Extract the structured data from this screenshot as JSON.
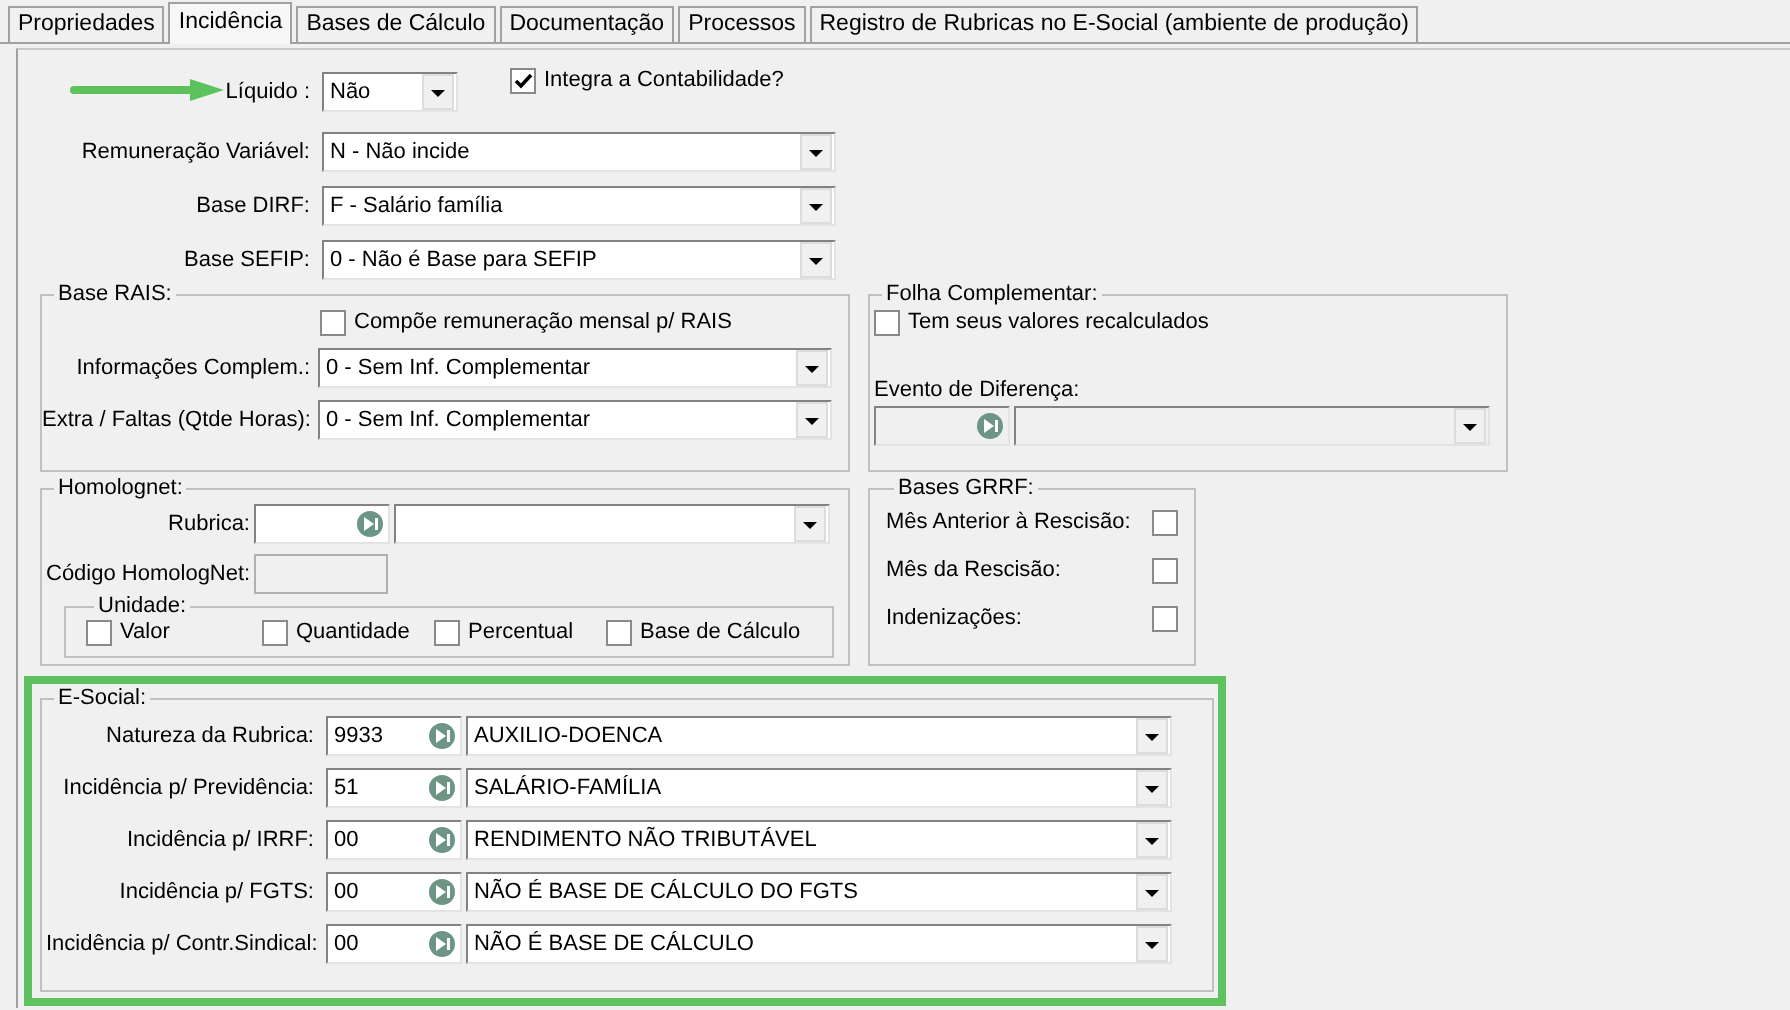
{
  "tabs": [
    {
      "label": "Propriedades",
      "selected": false
    },
    {
      "label": "Incidência",
      "selected": true
    },
    {
      "label": "Bases de Cálculo",
      "selected": false
    },
    {
      "label": "Documentação",
      "selected": false
    },
    {
      "label": "Processos",
      "selected": false
    },
    {
      "label": "Registro de Rubricas no E-Social (ambiente de produção)",
      "selected": false
    }
  ],
  "liquido": {
    "label": "Líquido :",
    "value": "Não"
  },
  "integra": {
    "label": "Integra a Contabilidade?",
    "checked": true
  },
  "selects": [
    {
      "label": "Remuneração Variável:",
      "value": "N - Não incide"
    },
    {
      "label": "Base DIRF:",
      "value": "F - Salário família"
    },
    {
      "label": "Base SEFIP:",
      "value": "0 - Não é Base para SEFIP"
    }
  ],
  "base_rais": {
    "title": "Base RAIS:",
    "checkbox": {
      "label": "Compõe remuneração mensal p/ RAIS",
      "checked": false
    },
    "selects": [
      {
        "label": "Informações Complem.:",
        "value": "0 - Sem Inf. Complementar"
      },
      {
        "label": "Extra / Faltas (Qtde Horas):",
        "value": "0 - Sem Inf. Complementar"
      }
    ]
  },
  "folha": {
    "title": "Folha Complementar:",
    "checkbox": {
      "label": "Tem seus valores recalculados",
      "checked": false
    },
    "evento": {
      "label": "Evento de Diferença:",
      "disabled": true
    }
  },
  "homolognet": {
    "title": "Homolognet:",
    "rubrica": {
      "label": "Rubrica:"
    },
    "codigo": {
      "label": "Código HomologNet:",
      "disabled": true
    },
    "unidade": {
      "title": "Unidade:",
      "options": [
        {
          "label": "Valor",
          "checked": false
        },
        {
          "label": "Quantidade",
          "checked": false
        },
        {
          "label": "Percentual",
          "checked": false
        },
        {
          "label": "Base de Cálculo",
          "checked": false
        }
      ]
    }
  },
  "grrf": {
    "title": "Bases GRRF:",
    "items": [
      {
        "label": "Mês Anterior à Rescisão:",
        "checked": false
      },
      {
        "label": "Mês da Rescisão:",
        "checked": false
      },
      {
        "label": "Indenizações:",
        "checked": false
      }
    ]
  },
  "esocial": {
    "title": "E-Social:",
    "rows": [
      {
        "label": "Natureza da Rubrica:",
        "code": "9933",
        "description": "AUXILIO-DOENCA"
      },
      {
        "label": "Incidência p/ Previdência:",
        "code": "51",
        "description": "SALÁRIO-FAMÍLIA"
      },
      {
        "label": "Incidência p/ IRRF:",
        "code": "00",
        "description": "RENDIMENTO NÃO TRIBUTÁVEL"
      },
      {
        "label": "Incidência p/ FGTS:",
        "code": "00",
        "description": "NÃO É BASE DE CÁLCULO DO FGTS"
      },
      {
        "label": "Incidência p/ Contr.Sindical:",
        "code": "00",
        "description": "NÃO É BASE DE CÁLCULO"
      }
    ]
  }
}
